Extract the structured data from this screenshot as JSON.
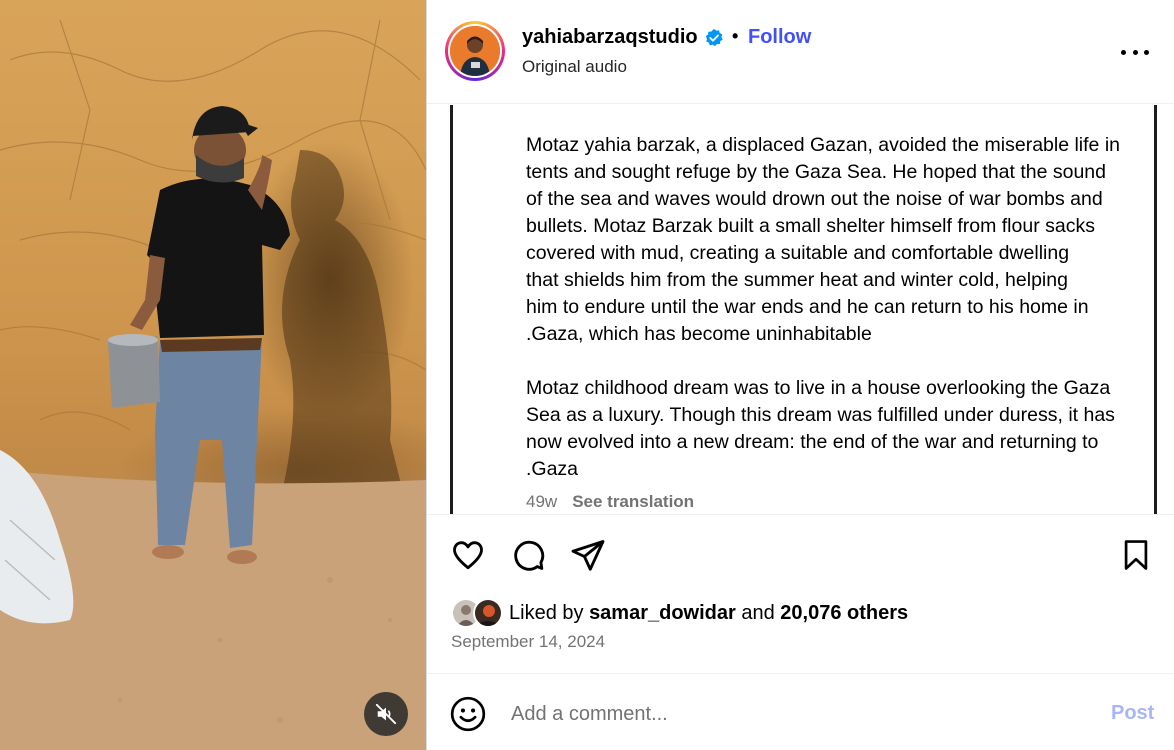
{
  "post": {
    "username": "yahiabarzaqstudio",
    "separator": "•",
    "follow_label": "Follow",
    "audio_label": "Original audio",
    "more_icon": "more-horizontal-icon"
  },
  "caption": {
    "paragraph1": [
      "Motaz yahia barzak, a displaced Gazan, avoided the miserable life in",
      "tents and sought refuge by the Gaza Sea. He hoped that the sound",
      "of the sea and waves would drown out the noise of war bombs and",
      "bullets. Motaz Barzak built a small shelter himself from flour sacks",
      "covered with mud, creating a suitable and comfortable dwelling",
      "that shields him from the summer heat and winter cold, helping",
      "him to endure until the war ends and he can return to his home in",
      ".Gaza, which has become uninhabitable"
    ],
    "paragraph2": [
      "Motaz childhood dream was to live in a house overlooking the Gaza",
      "Sea as a luxury. Though this dream was fulfilled under duress, it has",
      "now evolved into a new dream: the end of the war and returning to",
      ".Gaza"
    ],
    "age": "49w",
    "see_translation": "See translation"
  },
  "engagement": {
    "liked_by_prefix": "Liked by",
    "liked_by_user": "samar_dowidar",
    "and": "and",
    "others": "20,076 others",
    "date": "September 14, 2024"
  },
  "comment": {
    "placeholder": "Add a comment...",
    "post_label": "Post"
  },
  "colors": {
    "follow_blue": "#4150f7",
    "post_disabled": "#a8b6f8",
    "verified_blue": "#0095f6",
    "muted_text": "#737373"
  }
}
